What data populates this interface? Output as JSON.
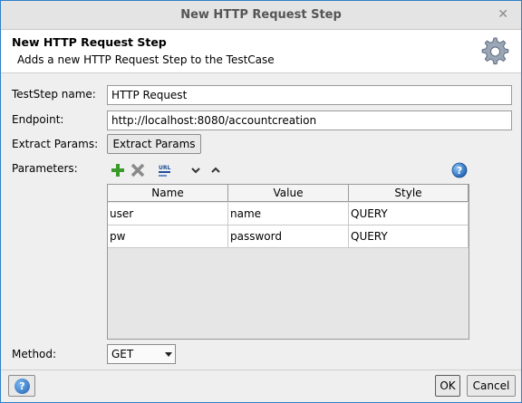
{
  "window": {
    "title": "New HTTP Request Step",
    "close_glyph": "✕"
  },
  "header": {
    "title": "New HTTP Request Step",
    "description": "Adds a new HTTP Request Step to the TestCase",
    "icon": "gear-icon"
  },
  "form": {
    "teststep_name_label": "TestStep name:",
    "teststep_name_value": "HTTP Request",
    "endpoint_label": "Endpoint:",
    "endpoint_value": "http://localhost:8080/accountcreation",
    "extract_params_label": "Extract Params:",
    "extract_params_button": "Extract Params",
    "parameters_label": "Parameters:",
    "method_label": "Method:",
    "method_value": "GET"
  },
  "toolbar": {
    "icons": [
      "add-icon",
      "delete-icon",
      "url-icon",
      "move-down-icon",
      "move-up-icon",
      "help-icon"
    ],
    "colors": {
      "add": "#3a9a2a",
      "delete": "#8a8a8a",
      "help": "#2a6fc4"
    }
  },
  "table": {
    "columns": [
      "Name",
      "Value",
      "Style"
    ],
    "rows": [
      {
        "name": "user",
        "value": "name",
        "style": "QUERY"
      },
      {
        "name": "pw",
        "value": "password",
        "style": "QUERY"
      }
    ]
  },
  "footer": {
    "ok_label": "OK",
    "cancel_label": "Cancel"
  }
}
